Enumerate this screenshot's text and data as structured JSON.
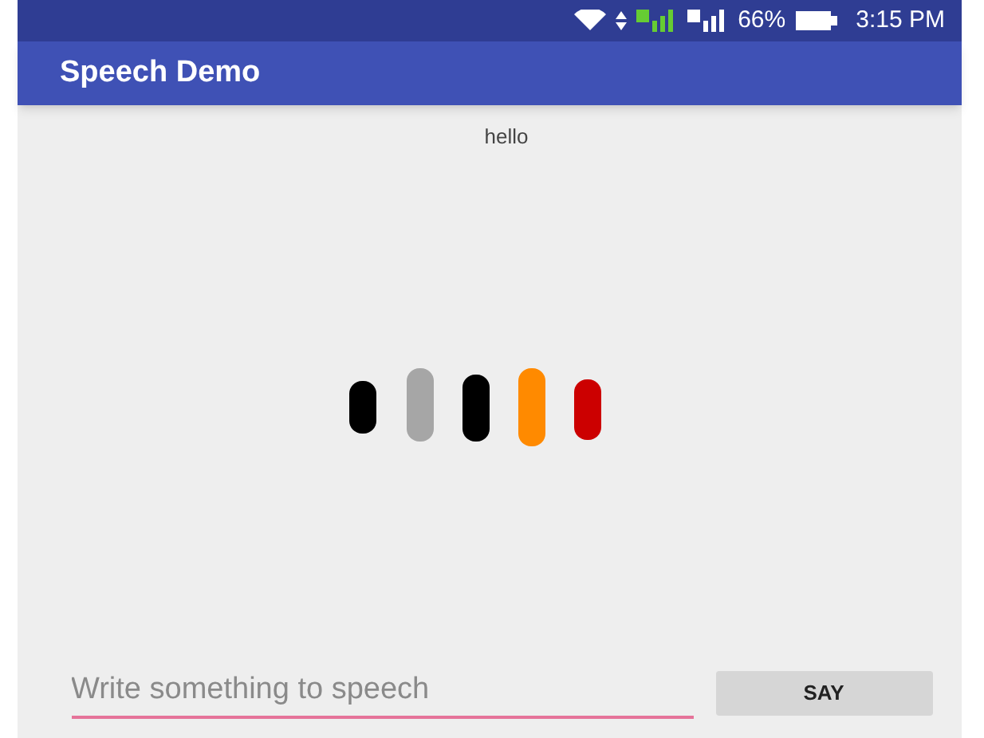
{
  "status_bar": {
    "battery": "66%",
    "time": "3:15 PM"
  },
  "app_bar": {
    "title": "Speech Demo"
  },
  "recognized_text": "hello",
  "input": {
    "placeholder": "Write something to speech"
  },
  "button": {
    "label": "SAY"
  }
}
